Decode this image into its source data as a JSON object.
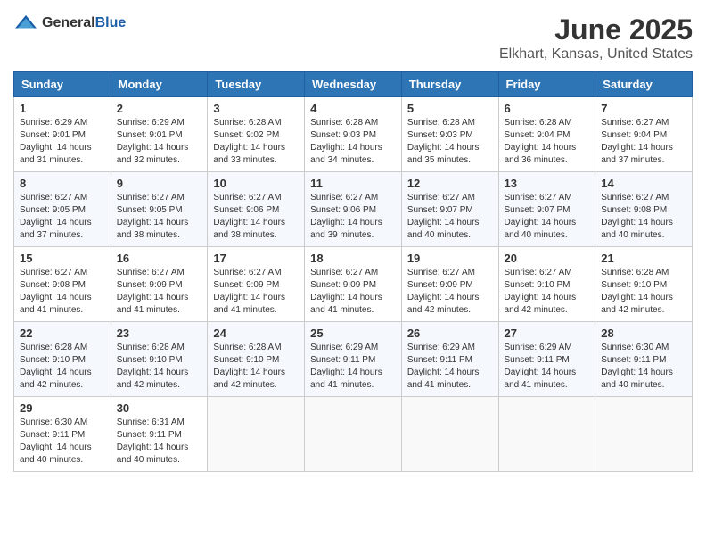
{
  "header": {
    "logo_general": "General",
    "logo_blue": "Blue",
    "month": "June 2025",
    "location": "Elkhart, Kansas, United States"
  },
  "weekdays": [
    "Sunday",
    "Monday",
    "Tuesday",
    "Wednesday",
    "Thursday",
    "Friday",
    "Saturday"
  ],
  "weeks": [
    [
      {
        "day": "1",
        "sunrise": "Sunrise: 6:29 AM",
        "sunset": "Sunset: 9:01 PM",
        "daylight": "Daylight: 14 hours and 31 minutes."
      },
      {
        "day": "2",
        "sunrise": "Sunrise: 6:29 AM",
        "sunset": "Sunset: 9:01 PM",
        "daylight": "Daylight: 14 hours and 32 minutes."
      },
      {
        "day": "3",
        "sunrise": "Sunrise: 6:28 AM",
        "sunset": "Sunset: 9:02 PM",
        "daylight": "Daylight: 14 hours and 33 minutes."
      },
      {
        "day": "4",
        "sunrise": "Sunrise: 6:28 AM",
        "sunset": "Sunset: 9:03 PM",
        "daylight": "Daylight: 14 hours and 34 minutes."
      },
      {
        "day": "5",
        "sunrise": "Sunrise: 6:28 AM",
        "sunset": "Sunset: 9:03 PM",
        "daylight": "Daylight: 14 hours and 35 minutes."
      },
      {
        "day": "6",
        "sunrise": "Sunrise: 6:28 AM",
        "sunset": "Sunset: 9:04 PM",
        "daylight": "Daylight: 14 hours and 36 minutes."
      },
      {
        "day": "7",
        "sunrise": "Sunrise: 6:27 AM",
        "sunset": "Sunset: 9:04 PM",
        "daylight": "Daylight: 14 hours and 37 minutes."
      }
    ],
    [
      {
        "day": "8",
        "sunrise": "Sunrise: 6:27 AM",
        "sunset": "Sunset: 9:05 PM",
        "daylight": "Daylight: 14 hours and 37 minutes."
      },
      {
        "day": "9",
        "sunrise": "Sunrise: 6:27 AM",
        "sunset": "Sunset: 9:05 PM",
        "daylight": "Daylight: 14 hours and 38 minutes."
      },
      {
        "day": "10",
        "sunrise": "Sunrise: 6:27 AM",
        "sunset": "Sunset: 9:06 PM",
        "daylight": "Daylight: 14 hours and 38 minutes."
      },
      {
        "day": "11",
        "sunrise": "Sunrise: 6:27 AM",
        "sunset": "Sunset: 9:06 PM",
        "daylight": "Daylight: 14 hours and 39 minutes."
      },
      {
        "day": "12",
        "sunrise": "Sunrise: 6:27 AM",
        "sunset": "Sunset: 9:07 PM",
        "daylight": "Daylight: 14 hours and 40 minutes."
      },
      {
        "day": "13",
        "sunrise": "Sunrise: 6:27 AM",
        "sunset": "Sunset: 9:07 PM",
        "daylight": "Daylight: 14 hours and 40 minutes."
      },
      {
        "day": "14",
        "sunrise": "Sunrise: 6:27 AM",
        "sunset": "Sunset: 9:08 PM",
        "daylight": "Daylight: 14 hours and 40 minutes."
      }
    ],
    [
      {
        "day": "15",
        "sunrise": "Sunrise: 6:27 AM",
        "sunset": "Sunset: 9:08 PM",
        "daylight": "Daylight: 14 hours and 41 minutes."
      },
      {
        "day": "16",
        "sunrise": "Sunrise: 6:27 AM",
        "sunset": "Sunset: 9:09 PM",
        "daylight": "Daylight: 14 hours and 41 minutes."
      },
      {
        "day": "17",
        "sunrise": "Sunrise: 6:27 AM",
        "sunset": "Sunset: 9:09 PM",
        "daylight": "Daylight: 14 hours and 41 minutes."
      },
      {
        "day": "18",
        "sunrise": "Sunrise: 6:27 AM",
        "sunset": "Sunset: 9:09 PM",
        "daylight": "Daylight: 14 hours and 41 minutes."
      },
      {
        "day": "19",
        "sunrise": "Sunrise: 6:27 AM",
        "sunset": "Sunset: 9:09 PM",
        "daylight": "Daylight: 14 hours and 42 minutes."
      },
      {
        "day": "20",
        "sunrise": "Sunrise: 6:27 AM",
        "sunset": "Sunset: 9:10 PM",
        "daylight": "Daylight: 14 hours and 42 minutes."
      },
      {
        "day": "21",
        "sunrise": "Sunrise: 6:28 AM",
        "sunset": "Sunset: 9:10 PM",
        "daylight": "Daylight: 14 hours and 42 minutes."
      }
    ],
    [
      {
        "day": "22",
        "sunrise": "Sunrise: 6:28 AM",
        "sunset": "Sunset: 9:10 PM",
        "daylight": "Daylight: 14 hours and 42 minutes."
      },
      {
        "day": "23",
        "sunrise": "Sunrise: 6:28 AM",
        "sunset": "Sunset: 9:10 PM",
        "daylight": "Daylight: 14 hours and 42 minutes."
      },
      {
        "day": "24",
        "sunrise": "Sunrise: 6:28 AM",
        "sunset": "Sunset: 9:10 PM",
        "daylight": "Daylight: 14 hours and 42 minutes."
      },
      {
        "day": "25",
        "sunrise": "Sunrise: 6:29 AM",
        "sunset": "Sunset: 9:11 PM",
        "daylight": "Daylight: 14 hours and 41 minutes."
      },
      {
        "day": "26",
        "sunrise": "Sunrise: 6:29 AM",
        "sunset": "Sunset: 9:11 PM",
        "daylight": "Daylight: 14 hours and 41 minutes."
      },
      {
        "day": "27",
        "sunrise": "Sunrise: 6:29 AM",
        "sunset": "Sunset: 9:11 PM",
        "daylight": "Daylight: 14 hours and 41 minutes."
      },
      {
        "day": "28",
        "sunrise": "Sunrise: 6:30 AM",
        "sunset": "Sunset: 9:11 PM",
        "daylight": "Daylight: 14 hours and 40 minutes."
      }
    ],
    [
      {
        "day": "29",
        "sunrise": "Sunrise: 6:30 AM",
        "sunset": "Sunset: 9:11 PM",
        "daylight": "Daylight: 14 hours and 40 minutes."
      },
      {
        "day": "30",
        "sunrise": "Sunrise: 6:31 AM",
        "sunset": "Sunset: 9:11 PM",
        "daylight": "Daylight: 14 hours and 40 minutes."
      },
      null,
      null,
      null,
      null,
      null
    ]
  ]
}
